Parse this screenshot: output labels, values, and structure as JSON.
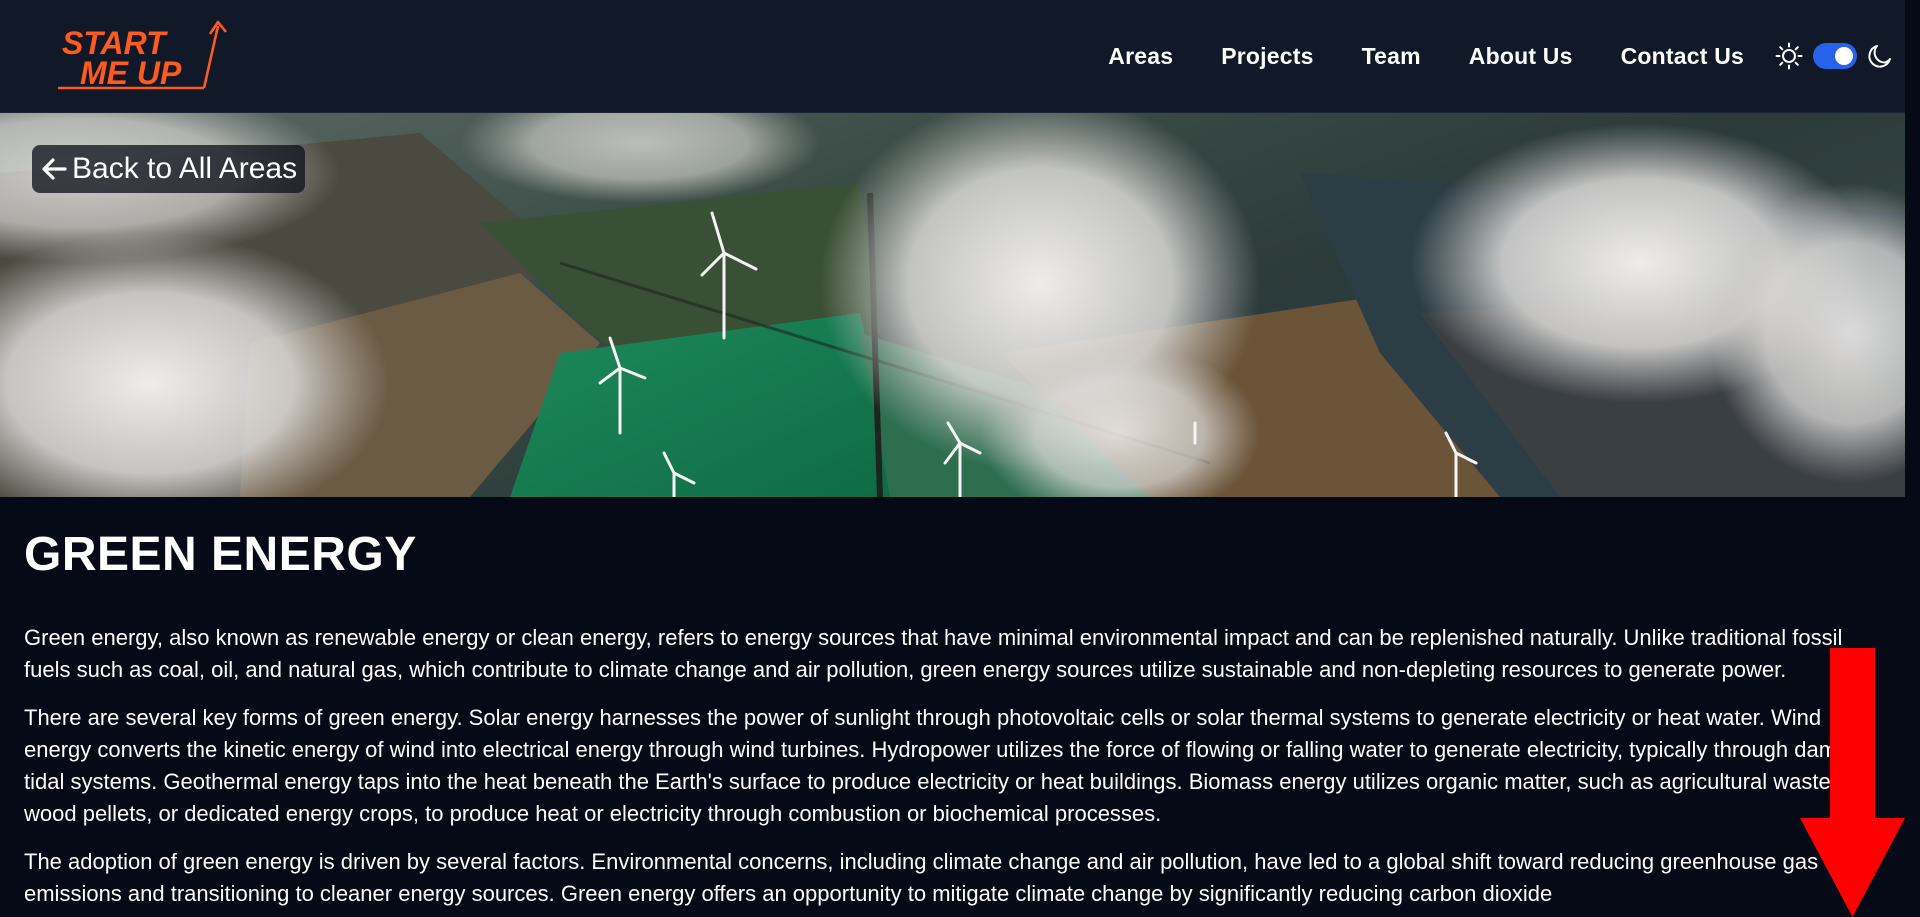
{
  "header": {
    "logo_text_line1": "START",
    "logo_text_line2": "ME UP",
    "logo_color": "#ff5a1f",
    "nav": [
      {
        "label": "Areas"
      },
      {
        "label": "Projects"
      },
      {
        "label": "Team"
      },
      {
        "label": "About Us"
      },
      {
        "label": "Contact Us"
      }
    ],
    "theme_toggle": {
      "light_icon": "sun-icon",
      "dark_icon": "moon-icon",
      "state": "on",
      "accent": "#2563eb"
    }
  },
  "hero": {
    "image_subject": "aerial view of wind turbines over green fields with clouds",
    "back_button_label": "Back to All Areas",
    "back_icon": "arrow-left-icon"
  },
  "main": {
    "title": "GREEN ENERGY",
    "paragraphs": [
      "Green energy, also known as renewable energy or clean energy, refers to energy sources that have minimal environmental impact and can be replenished naturally. Unlike traditional fossil fuels such as coal, oil, and natural gas, which contribute to climate change and air pollution, green energy sources utilize sustainable and non-depleting resources to generate power.",
      "There are several key forms of green energy. Solar energy harnesses the power of sunlight through photovoltaic cells or solar thermal systems to generate electricity or heat water. Wind energy converts the kinetic energy of wind into electrical energy through wind turbines. Hydropower utilizes the force of flowing or falling water to generate electricity, typically through dams or tidal systems. Geothermal energy taps into the heat beneath the Earth's surface to produce electricity or heat buildings. Biomass energy utilizes organic matter, such as agricultural waste, wood pellets, or dedicated energy crops, to produce heat or electricity through combustion or biochemical processes.",
      "The adoption of green energy is driven by several factors. Environmental concerns, including climate change and air pollution, have led to a global shift toward reducing greenhouse gas emissions and transitioning to cleaner energy sources. Green energy offers an opportunity to mitigate climate change by significantly reducing carbon dioxide"
    ]
  },
  "overlay": {
    "scroll_arrow_icon": "arrow-down-icon",
    "scroll_arrow_color": "#ff0000"
  }
}
